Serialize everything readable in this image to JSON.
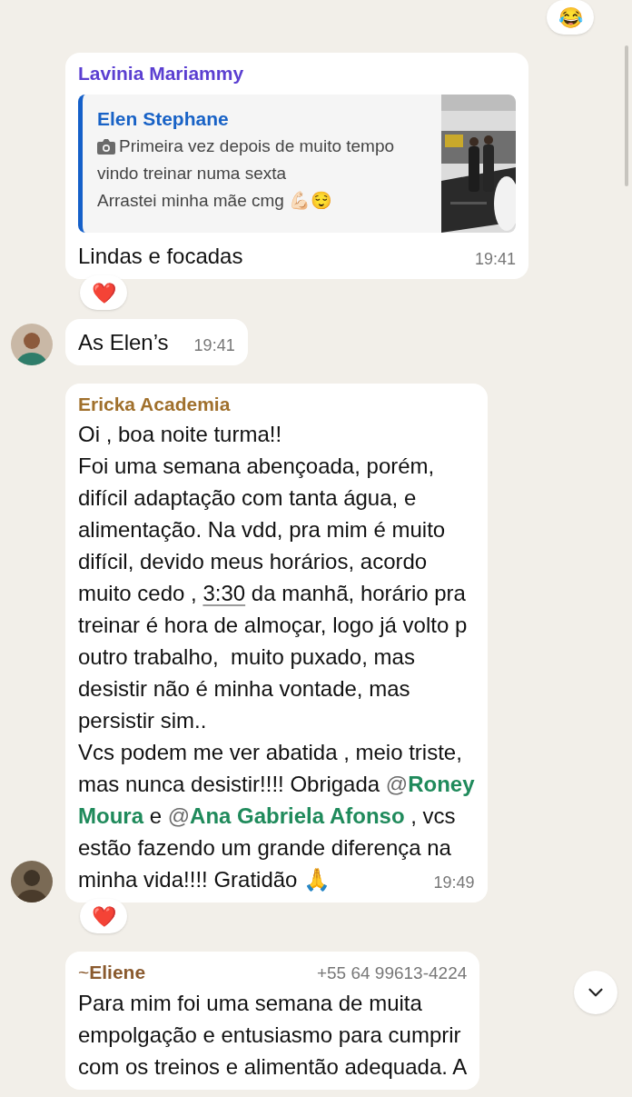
{
  "top_reaction": {
    "emoji": "😂"
  },
  "messages": [
    {
      "kind": "reply",
      "avatar": false,
      "sender": {
        "name": "Lavinia Mariammy",
        "color": "#5b3fd1"
      },
      "quote": {
        "author": "Elen Stephane",
        "lines": [
          "Primeira vez depois de muito tempo",
          "vindo treinar numa sexta",
          "Arrastei minha mãe cmg 💪🏻😌"
        ]
      },
      "lines": [
        [
          {
            "kind": "text",
            "text": "Lindas e focadas"
          }
        ]
      ],
      "time": "19:41",
      "reaction": "❤️"
    },
    {
      "kind": "text",
      "avatar": true,
      "lines": [
        [
          {
            "kind": "text",
            "text": "As Elen’s"
          }
        ]
      ],
      "time": "19:41"
    },
    {
      "kind": "text",
      "avatar": true,
      "sender": {
        "name": "Ericka Academia",
        "color": "#a0702c"
      },
      "lines": [
        [
          {
            "kind": "text",
            "text": "Oi , boa noite turma!!"
          }
        ],
        [
          {
            "kind": "text",
            "text": "Foi uma semana abençoada, porém,"
          }
        ],
        [
          {
            "kind": "text",
            "text": "difícil adaptação com tanta água, e"
          }
        ],
        [
          {
            "kind": "text",
            "text": "alimentação. Na vdd, pra mim é muito"
          }
        ],
        [
          {
            "kind": "text",
            "text": "difícil, devido meus horários, acordo"
          }
        ],
        [
          {
            "kind": "text",
            "text": "muito cedo , "
          },
          {
            "kind": "time_link",
            "text": "3:30"
          },
          {
            "kind": "text",
            "text": " da manhã, horário pra"
          }
        ],
        [
          {
            "kind": "text",
            "text": "treinar é hora de almoçar, logo já volto p"
          }
        ],
        [
          {
            "kind": "text",
            "text": "outro trabalho,  muito puxado, mas"
          }
        ],
        [
          {
            "kind": "text",
            "text": "desistir não é minha vontade, mas"
          }
        ],
        [
          {
            "kind": "text",
            "text": "persistir sim.."
          }
        ],
        [
          {
            "kind": "text",
            "text": "Vcs podem me ver abatida , meio triste,"
          }
        ],
        [
          {
            "kind": "text",
            "text": "mas nunca desistir!!!! Obrigada "
          },
          {
            "kind": "mention",
            "at": "@",
            "text": "Roney"
          }
        ],
        [
          {
            "kind": "mention",
            "text": "Moura"
          },
          {
            "kind": "text",
            "text": " e "
          },
          {
            "kind": "mention",
            "at": "@",
            "text": "Ana Gabriela Afonso"
          },
          {
            "kind": "text",
            "text": " , vcs"
          }
        ],
        [
          {
            "kind": "text",
            "text": "estão fazendo um grande diferença na"
          }
        ],
        [
          {
            "kind": "text",
            "text": "minha vida!!!! Gratidão 🙏"
          }
        ]
      ],
      "time": "19:49",
      "reaction": "❤️"
    },
    {
      "kind": "text",
      "avatar": false,
      "sender": {
        "prefix": "~",
        "name": "Eliene",
        "color": "#8a5a2e"
      },
      "phone": "+55 64 99613-4224",
      "lines": [
        [
          {
            "kind": "text",
            "text": "Para mim foi uma semana de muita"
          }
        ],
        [
          {
            "kind": "text",
            "text": "empolgação e entusiasmo para cumprir"
          }
        ],
        [
          {
            "kind": "text",
            "text": "com os treinos e alimentão adequada. A"
          }
        ]
      ]
    }
  ]
}
